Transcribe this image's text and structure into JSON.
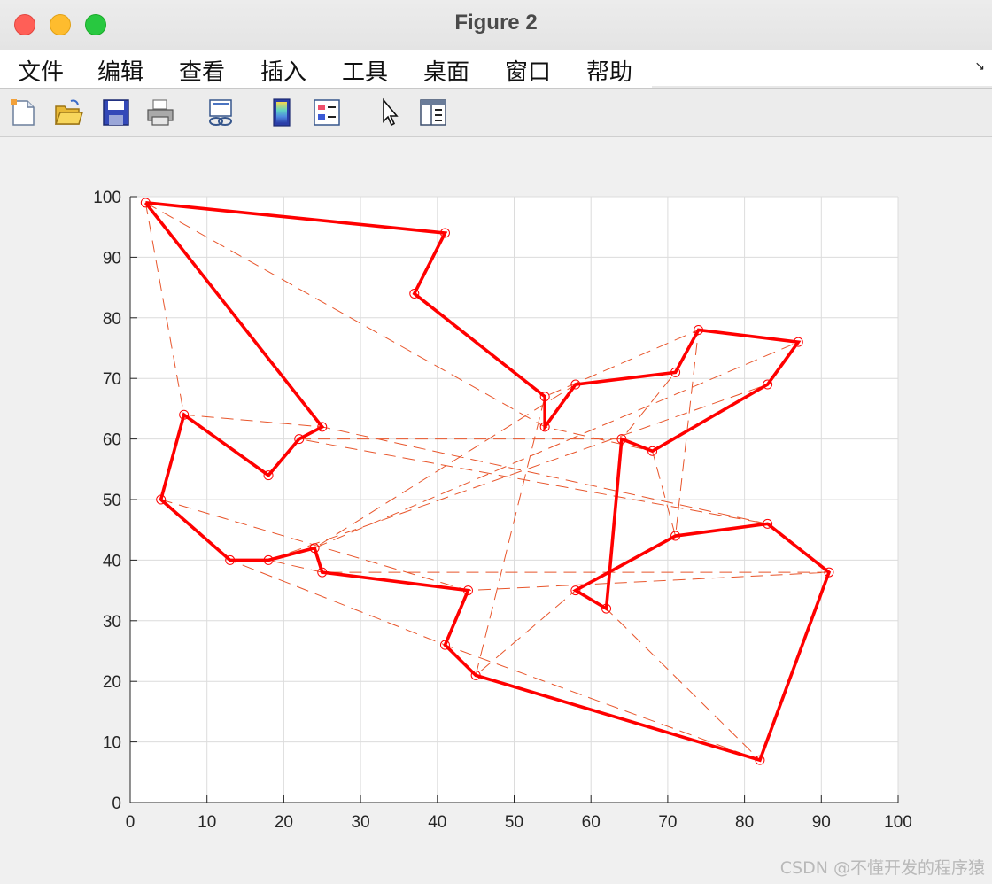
{
  "window": {
    "title": "Figure 2"
  },
  "menu": {
    "items": [
      {
        "label": "文件",
        "name": "menu-file"
      },
      {
        "label": "编辑",
        "name": "menu-edit"
      },
      {
        "label": "查看",
        "name": "menu-view"
      },
      {
        "label": "插入",
        "name": "menu-insert"
      },
      {
        "label": "工具",
        "name": "menu-tools"
      },
      {
        "label": "桌面",
        "name": "menu-desktop"
      },
      {
        "label": "窗口",
        "name": "menu-window"
      },
      {
        "label": "帮助",
        "name": "menu-help"
      }
    ],
    "overflow_arrow": "↘"
  },
  "toolbar": {
    "icons": [
      "new-figure-icon",
      "open-file-icon",
      "save-icon",
      "print-icon",
      "link-plot-icon",
      "colorbar-icon",
      "legend-icon",
      "pointer-icon",
      "property-editor-icon"
    ]
  },
  "watermark": "CSDN @不懂开发的程序猿",
  "chart_data": {
    "type": "line",
    "title": "",
    "xlabel": "",
    "ylabel": "",
    "xlim": [
      0,
      100
    ],
    "ylim": [
      0,
      100
    ],
    "xticks": [
      0,
      10,
      20,
      30,
      40,
      50,
      60,
      70,
      80,
      90,
      100
    ],
    "yticks": [
      0,
      10,
      20,
      30,
      40,
      50,
      60,
      70,
      80,
      90,
      100
    ],
    "grid": true,
    "colors": {
      "solid": "#ff0000",
      "dashed": "#e8552b",
      "marker": "#ff0000"
    },
    "points": [
      [
        2,
        99
      ],
      [
        41,
        94
      ],
      [
        37,
        84
      ],
      [
        54,
        67
      ],
      [
        54,
        62
      ],
      [
        58,
        69
      ],
      [
        71,
        71
      ],
      [
        74,
        78
      ],
      [
        87,
        76
      ],
      [
        83,
        69
      ],
      [
        68,
        58
      ],
      [
        64,
        60
      ],
      [
        62,
        32
      ],
      [
        58,
        35
      ],
      [
        71,
        44
      ],
      [
        83,
        46
      ],
      [
        91,
        38
      ],
      [
        82,
        7
      ],
      [
        45,
        21
      ],
      [
        41,
        26
      ],
      [
        44,
        35
      ],
      [
        25,
        38
      ],
      [
        24,
        42
      ],
      [
        18,
        40
      ],
      [
        13,
        40
      ],
      [
        4,
        50
      ],
      [
        7,
        64
      ],
      [
        18,
        54
      ],
      [
        22,
        60
      ],
      [
        25,
        62
      ]
    ],
    "series": [
      {
        "style": "solid",
        "closed": true,
        "x": [
          2,
          41,
          37,
          54,
          54,
          58,
          71,
          74,
          87,
          83,
          68,
          64,
          62,
          58,
          71,
          83,
          91,
          82,
          45,
          41,
          44,
          25,
          24,
          18,
          13,
          4,
          7,
          18,
          22,
          25
        ],
        "y": [
          99,
          94,
          84,
          67,
          62,
          69,
          71,
          78,
          76,
          69,
          58,
          60,
          32,
          35,
          44,
          46,
          38,
          7,
          21,
          26,
          35,
          38,
          42,
          40,
          40,
          50,
          64,
          54,
          60,
          62
        ]
      },
      {
        "style": "dashed",
        "closed": true,
        "x": [
          2,
          54,
          68,
          71,
          74,
          54,
          45,
          58,
          62,
          82,
          41,
          13,
          4,
          44,
          91,
          25,
          18,
          83,
          87,
          24,
          58,
          71,
          64,
          22,
          83,
          25,
          7,
          2
        ],
        "y": [
          99,
          62,
          58,
          44,
          78,
          67,
          21,
          35,
          32,
          7,
          26,
          40,
          50,
          35,
          38,
          38,
          40,
          69,
          76,
          42,
          69,
          71,
          60,
          60,
          46,
          62,
          64,
          99
        ]
      }
    ]
  }
}
